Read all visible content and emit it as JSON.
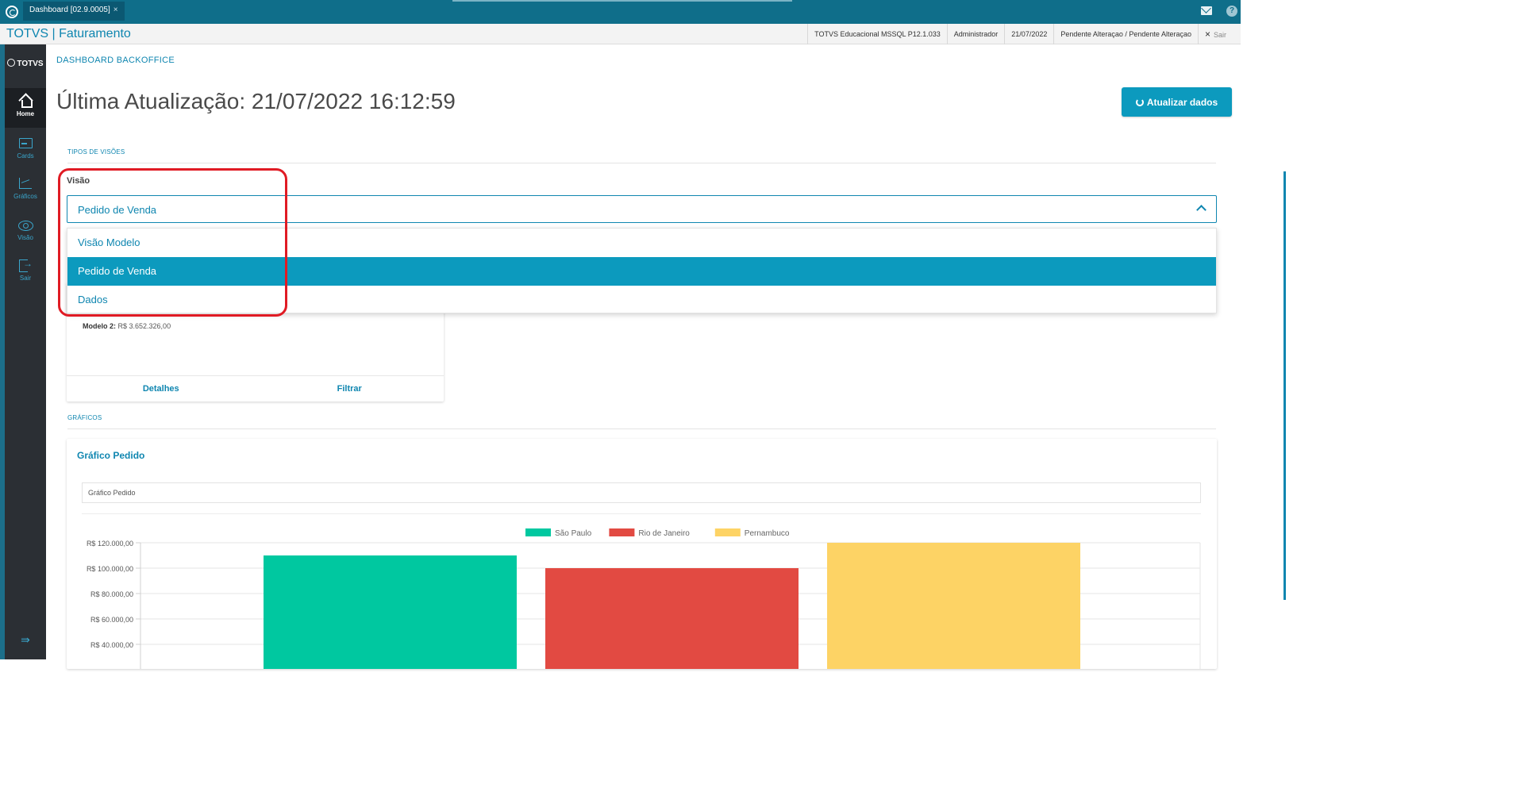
{
  "topbar": {
    "tab_label": "Dashboard [02.9.0005]",
    "tab_close": "×"
  },
  "header": {
    "title": "TOTVS | Faturamento",
    "environment": "TOTVS Educacional MSSQL P12.1.033",
    "user": "Administrador",
    "date": "21/07/2022",
    "status": "Pendente Alteraçao / Pendente Alteraçao",
    "logout_label": "Sair",
    "logout_icon": "×"
  },
  "sidenav": {
    "brand": "TOTVS",
    "items": [
      {
        "label": "Home",
        "icon": "home-icon"
      },
      {
        "label": "Cards",
        "icon": "cards-icon"
      },
      {
        "label": "Gráficos",
        "icon": "chart-icon"
      },
      {
        "label": "Visão",
        "icon": "eye-icon"
      },
      {
        "label": "Sair",
        "icon": "exit-icon"
      }
    ],
    "collapse_icon": "⇛"
  },
  "main": {
    "breadcrumb": "DASHBOARD BACKOFFICE",
    "title": "Última Atualização: 21/07/2022 16:12:59",
    "refresh_label": "Atualizar dados",
    "section_views": "TIPOS DE VISÕES",
    "visao_label": "Visão",
    "select_value": "Pedido de Venda",
    "options": [
      "Visão Modelo",
      "Pedido de Venda",
      "Dados"
    ],
    "selected_option": "Pedido de Venda",
    "card": {
      "model2_label": "Modelo 2:",
      "model2_value": "R$ 3.652.326,00",
      "details_label": "Detalhes",
      "filter_label": "Filtrar"
    },
    "section_charts": "GRÁFICOS",
    "chart_title": "Gráfico Pedido",
    "chart_filter_text": "Gráfico Pedido"
  },
  "colors": {
    "accent": "#0f86b0",
    "selected": "#0c9abe",
    "sao_paulo": "#00c8a0",
    "rio": "#e24a42",
    "pernambuco": "#fdd365"
  },
  "chart_data": {
    "type": "bar",
    "categories": [
      ""
    ],
    "series": [
      {
        "name": "São Paulo",
        "values": [
          110000
        ]
      },
      {
        "name": "Rio de Janeiro",
        "values": [
          100000
        ]
      },
      {
        "name": "Pernambuco",
        "values": [
          120000
        ]
      }
    ],
    "y_ticks": [
      "R$ 120.000,00",
      "R$ 100.000,00",
      "R$ 80.000,00",
      "R$ 60.000,00",
      "R$ 40.000,00"
    ],
    "ylim": [
      0,
      120000
    ],
    "grid": true,
    "legend_position": "top"
  }
}
